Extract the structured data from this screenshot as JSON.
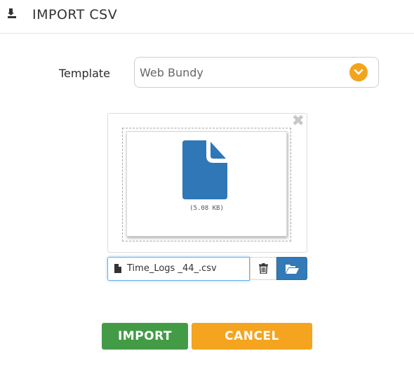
{
  "header": {
    "title": "IMPORT CSV",
    "icon": "file-import-icon"
  },
  "form": {
    "template_label": "Template",
    "template_value": "Web Bundy"
  },
  "preview": {
    "file_size": "(5.08 KB)",
    "file_icon": "file-icon"
  },
  "file_input": {
    "filename": "Time_Logs _44_.csv"
  },
  "buttons": {
    "import": "IMPORT",
    "cancel": "CANCEL"
  },
  "colors": {
    "accent_orange": "#f4a41f",
    "import_green": "#439b46",
    "browse_blue": "#337ab7",
    "file_icon_blue": "#2f77b7"
  }
}
